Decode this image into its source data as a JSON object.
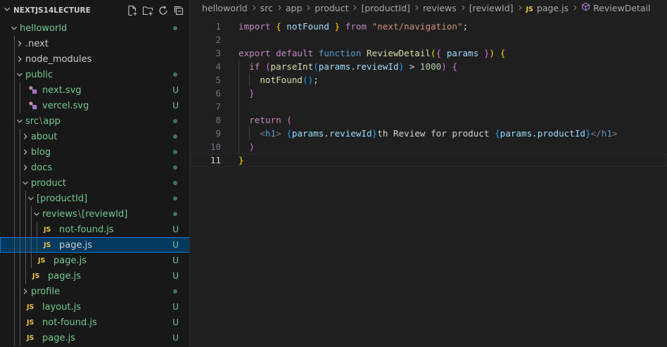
{
  "explorer": {
    "title": "NEXTJS14LECTURE",
    "actions": [
      {
        "name": "new-file-icon"
      },
      {
        "name": "new-folder-icon"
      },
      {
        "name": "refresh-icon"
      },
      {
        "name": "collapse-all-icon"
      }
    ],
    "colors": {
      "added": "#73c991",
      "selected_bg": "#04395e",
      "selected_border": "#0078d4",
      "js_icon": "#e8c24a"
    },
    "tree": [
      {
        "label": "helloworld",
        "depth": 0,
        "type": "folder",
        "expanded": true,
        "status": "dot",
        "added": true
      },
      {
        "label": ".next",
        "depth": 1,
        "type": "folder",
        "expanded": false,
        "status": "",
        "added": false
      },
      {
        "label": "node_modules",
        "depth": 1,
        "type": "folder",
        "expanded": false,
        "status": "",
        "added": false
      },
      {
        "label": "public",
        "depth": 1,
        "type": "folder",
        "expanded": true,
        "status": "dot",
        "added": true
      },
      {
        "label": "next.svg",
        "depth": 2,
        "type": "svg",
        "status": "U",
        "added": true
      },
      {
        "label": "vercel.svg",
        "depth": 2,
        "type": "svg",
        "status": "U",
        "added": true
      },
      {
        "label": "src",
        "label2": "app",
        "depth": 1,
        "type": "folder",
        "expanded": true,
        "status": "dot",
        "added": true
      },
      {
        "label": "about",
        "depth": 2,
        "type": "folder",
        "expanded": false,
        "status": "dot",
        "added": true
      },
      {
        "label": "blog",
        "depth": 2,
        "type": "folder",
        "expanded": false,
        "status": "dot",
        "added": true
      },
      {
        "label": "docs",
        "depth": 2,
        "type": "folder",
        "expanded": false,
        "status": "dot",
        "added": true
      },
      {
        "label": "product",
        "depth": 2,
        "type": "folder",
        "expanded": true,
        "status": "dot",
        "added": true
      },
      {
        "label": "[productId]",
        "depth": 3,
        "type": "folder",
        "expanded": true,
        "status": "dot",
        "added": true
      },
      {
        "label": "reviews",
        "label2": "[reviewId]",
        "depth": 4,
        "type": "folder",
        "expanded": true,
        "status": "dot",
        "added": true
      },
      {
        "label": "not-found.js",
        "depth": 5,
        "type": "js",
        "status": "U",
        "added": true
      },
      {
        "label": "page.js",
        "depth": 5,
        "type": "js",
        "status": "U",
        "added": false,
        "selected": true
      },
      {
        "label": "page.js",
        "depth": 4,
        "type": "js",
        "status": "U",
        "added": true
      },
      {
        "label": "page.js",
        "depth": 3,
        "type": "js",
        "status": "U",
        "added": true
      },
      {
        "label": "profile",
        "depth": 2,
        "type": "folder",
        "expanded": false,
        "status": "dot",
        "added": true
      },
      {
        "label": "layout.js",
        "depth": 2,
        "type": "js",
        "status": "U",
        "added": true
      },
      {
        "label": "not-found.js",
        "depth": 2,
        "type": "js",
        "status": "U",
        "added": true
      },
      {
        "label": "page.js",
        "depth": 2,
        "type": "js",
        "status": "U",
        "added": true
      }
    ]
  },
  "editor": {
    "breadcrumbs": [
      "helloworld",
      "src",
      "app",
      "product",
      "[productId]",
      "reviews",
      "[reviewId]",
      "page.js",
      "ReviewDetail"
    ],
    "js_badge": "JS",
    "current_line": 11,
    "lines": [
      {
        "n": 1,
        "indent": 0,
        "tokens": [
          [
            "kw",
            "import"
          ],
          [
            "t",
            " "
          ],
          [
            "b1",
            "{"
          ],
          [
            "t",
            " "
          ],
          [
            "var",
            "notFound"
          ],
          [
            "t",
            " "
          ],
          [
            "b1",
            "}"
          ],
          [
            "t",
            " "
          ],
          [
            "kw",
            "from"
          ],
          [
            "t",
            " "
          ],
          [
            "str",
            "\"next/navigation\""
          ],
          [
            "t",
            ";"
          ]
        ]
      },
      {
        "n": 2,
        "indent": 0,
        "tokens": []
      },
      {
        "n": 3,
        "indent": 0,
        "tokens": [
          [
            "kw",
            "export"
          ],
          [
            "t",
            " "
          ],
          [
            "kw",
            "default"
          ],
          [
            "t",
            " "
          ],
          [
            "kw2",
            "function"
          ],
          [
            "t",
            " "
          ],
          [
            "fn",
            "ReviewDetail"
          ],
          [
            "b1",
            "("
          ],
          [
            "b2",
            "{"
          ],
          [
            "t",
            " "
          ],
          [
            "var",
            "params"
          ],
          [
            "t",
            " "
          ],
          [
            "b2",
            "}"
          ],
          [
            "b1",
            ")"
          ],
          [
            "t",
            " "
          ],
          [
            "b1",
            "{"
          ]
        ]
      },
      {
        "n": 4,
        "indent": 1,
        "tokens": [
          [
            "kw",
            "if"
          ],
          [
            "t",
            " "
          ],
          [
            "b2",
            "("
          ],
          [
            "fn",
            "parseInt"
          ],
          [
            "b3",
            "("
          ],
          [
            "var",
            "params"
          ],
          [
            "t",
            "."
          ],
          [
            "var",
            "reviewId"
          ],
          [
            "b3",
            ")"
          ],
          [
            "t",
            " > "
          ],
          [
            "num",
            "1000"
          ],
          [
            "b2",
            ")"
          ],
          [
            "t",
            " "
          ],
          [
            "b2",
            "{"
          ]
        ]
      },
      {
        "n": 5,
        "indent": 2,
        "tokens": [
          [
            "fn",
            "notFound"
          ],
          [
            "b3",
            "()"
          ],
          [
            "t",
            ";"
          ]
        ]
      },
      {
        "n": 6,
        "indent": 1,
        "tokens": [
          [
            "b2",
            "}"
          ]
        ]
      },
      {
        "n": 7,
        "indent": 1,
        "tokens": []
      },
      {
        "n": 8,
        "indent": 1,
        "tokens": [
          [
            "kw",
            "return"
          ],
          [
            "t",
            " "
          ],
          [
            "b2",
            "("
          ]
        ]
      },
      {
        "n": 9,
        "indent": 2,
        "tokens": [
          [
            "ang",
            "<"
          ],
          [
            "tag",
            "h1"
          ],
          [
            "ang",
            ">"
          ],
          [
            "t",
            " "
          ],
          [
            "b3",
            "{"
          ],
          [
            "var",
            "params"
          ],
          [
            "t",
            "."
          ],
          [
            "var",
            "reviewId"
          ],
          [
            "b3",
            "}"
          ],
          [
            "t",
            "th Review for product "
          ],
          [
            "b3",
            "{"
          ],
          [
            "var",
            "params"
          ],
          [
            "t",
            "."
          ],
          [
            "var",
            "productId"
          ],
          [
            "b3",
            "}"
          ],
          [
            "ang",
            "</"
          ],
          [
            "tag",
            "h1"
          ],
          [
            "ang",
            ">"
          ]
        ]
      },
      {
        "n": 10,
        "indent": 1,
        "tokens": [
          [
            "b2",
            ")"
          ]
        ]
      },
      {
        "n": 11,
        "indent": 0,
        "tokens": [
          [
            "b1",
            "}"
          ]
        ]
      }
    ]
  }
}
